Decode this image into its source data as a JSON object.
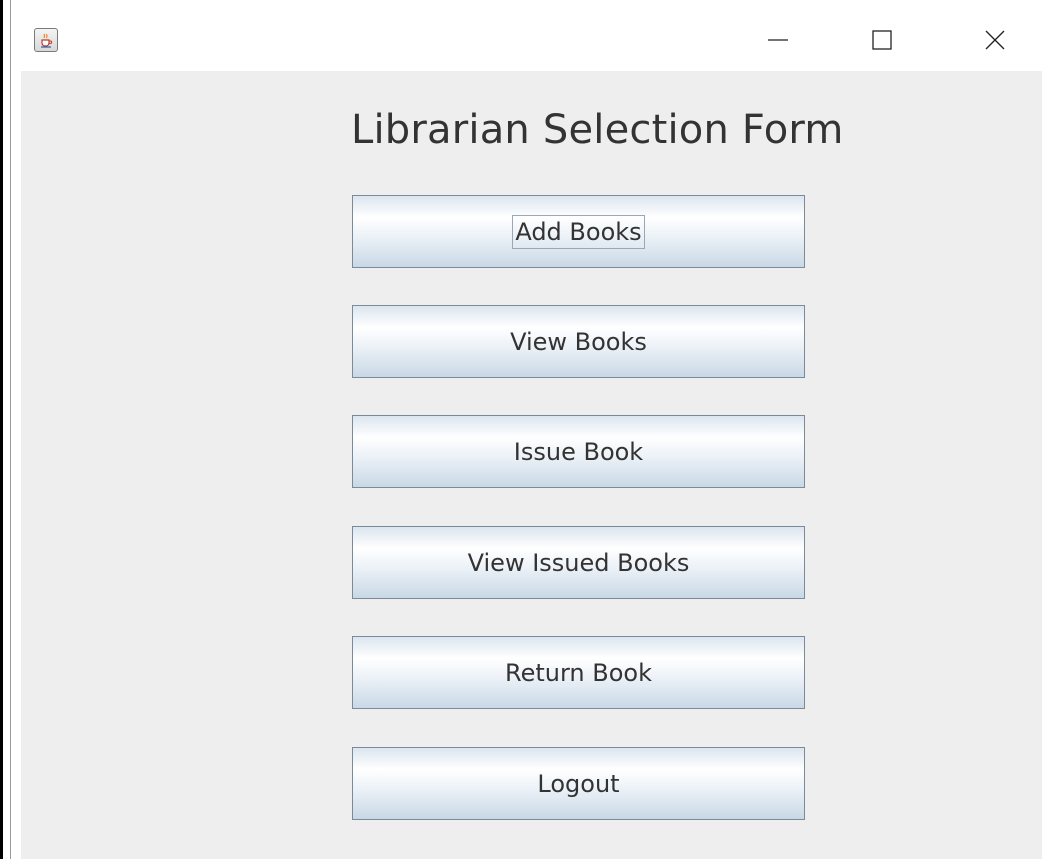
{
  "window": {
    "title_icon": "java-cup-icon",
    "controls": {
      "minimize": "minimize-icon",
      "maximize": "maximize-icon",
      "close": "close-icon"
    }
  },
  "form": {
    "title": "Librarian Selection Form",
    "buttons": [
      {
        "label": "Add Books",
        "focused": true
      },
      {
        "label": "View Books",
        "focused": false
      },
      {
        "label": "Issue Book",
        "focused": false
      },
      {
        "label": "View Issued Books",
        "focused": false
      },
      {
        "label": "Return Book",
        "focused": false
      },
      {
        "label": "Logout",
        "focused": false
      }
    ]
  },
  "colors": {
    "content_background": "#eeeeee",
    "button_border": "#7a8a99",
    "text": "#333333"
  }
}
